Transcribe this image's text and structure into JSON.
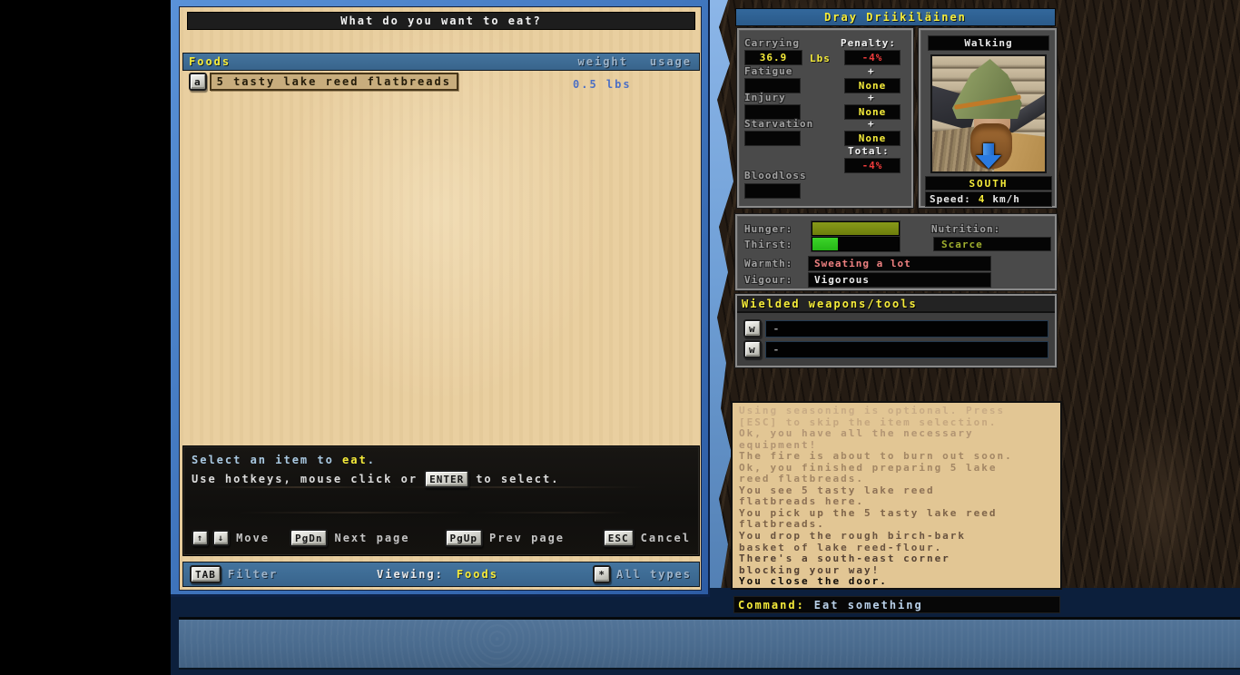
{
  "dialog": {
    "title": "What do you want to eat?",
    "list_header": {
      "category": "Foods",
      "weight_col": "weight",
      "usage_col": "usage"
    },
    "items": [
      {
        "hotkey": "a",
        "name": "5 tasty lake reed flatbreads",
        "weight": "0.5 lbs"
      }
    ],
    "prompt": {
      "line1_pre": "Select an item to ",
      "line1_verb": "eat",
      "line1_post": ".",
      "line2_pre": "Use hotkeys, mouse click or",
      "enter_key": "ENTER",
      "line2_post": "to select."
    },
    "nav": {
      "up_key": "↑",
      "down_key": "↓",
      "move_label": "Move",
      "pgdn_key": "PgDn",
      "next_label": "Next page",
      "pgup_key": "PgUp",
      "prev_label": "Prev page",
      "esc_key": "ESC",
      "cancel_label": "Cancel"
    },
    "filter_bar": {
      "tab_key": "TAB",
      "filter_label": "Filter",
      "viewing_label": "Viewing:",
      "viewing_value": "Foods",
      "star_key": "*",
      "all_types_label": "All types"
    }
  },
  "character": {
    "name": "Dray Driikiläinen",
    "stats": {
      "carrying_label": "Carrying",
      "carrying_value": "36.9",
      "carrying_unit": "Lbs",
      "penalty_label": "Penalty:",
      "penalty_value": "-4%",
      "fatigue_label": "Fatigue",
      "fatigue_value": "",
      "injury_label": "Injury",
      "injury_value": "",
      "starvation_label": "Starvation",
      "starvation_value": "",
      "plus1": "+",
      "plus2": "+",
      "plus3": "+",
      "fatigue_penalty": "None",
      "injury_penalty": "None",
      "starvation_penalty": "None",
      "total_label": "Total:",
      "total_value": "-4%",
      "bloodloss_label": "Bloodloss",
      "bloodloss_value": ""
    },
    "movement": {
      "mode": "Walking",
      "direction": "SOUTH",
      "speed_label": "Speed:",
      "speed_value": "4",
      "speed_unit": "km/h"
    },
    "condition": {
      "hunger_label": "Hunger:",
      "hunger_fill_pct": 100,
      "thirst_label": "Thirst:",
      "thirst_fill_pct": 29,
      "nutrition_label": "Nutrition:",
      "nutrition_value": "Scarce",
      "warmth_label": "Warmth:",
      "warmth_value": "Sweating a lot",
      "vigour_label": "Vigour:",
      "vigour_value": "Vigorous"
    },
    "wielded": {
      "title": "Wielded weapons/tools",
      "slots": [
        {
          "hotkey": "w",
          "item": "-"
        },
        {
          "hotkey": "w",
          "item": "-"
        }
      ]
    }
  },
  "log": {
    "lines": [
      {
        "text": "Using seasoning is optional. Press",
        "color": "#c9ac85"
      },
      {
        "text": "[ESC] to skip the item selection.",
        "color": "#c5a77f"
      },
      {
        "text": "Ok, you have all the necessary",
        "color": "#b29573"
      },
      {
        "text": "equipment!",
        "color": "#b29573"
      },
      {
        "text": "The fire is about to burn out soon.",
        "color": "#a38765"
      },
      {
        "text": "Ok, you finished preparing 5 lake",
        "color": "#a38765"
      },
      {
        "text": "reed flatbreads.",
        "color": "#a38765"
      },
      {
        "text": "You see 5 tasty lake reed",
        "color": "#8e7256"
      },
      {
        "text": "flatbreads here.",
        "color": "#8e7256"
      },
      {
        "text": "You pick up the 5 tasty lake reed",
        "color": "#7f654a"
      },
      {
        "text": "flatbreads.",
        "color": "#7f654a"
      },
      {
        "text": "You drop the rough birch-bark",
        "color": "#6a5440"
      },
      {
        "text": "basket of lake reed-flour.",
        "color": "#6a5440"
      },
      {
        "text": "There's a south-east corner",
        "color": "#544133"
      },
      {
        "text": "blocking your way!",
        "color": "#544133"
      },
      {
        "text": "You close the door.",
        "color": "#0e0b07"
      }
    ]
  },
  "command": {
    "label": "Command:",
    "value": "Eat something"
  },
  "colors": {
    "accent_yellow": "#f6ec3a",
    "penalty_red": "#f03c3c",
    "weight_blue": "#4d70c4",
    "bar_blue": "#3d6b94",
    "parchment": "#e9cfa0",
    "log_parchment": "#e2c694",
    "hunger_olive": "#7b8e12",
    "thirst_green": "#2ec81e",
    "nutrition_olive": "#9fae2e",
    "warmth_salmon": "#ee8080",
    "command_blue": "#b9d1ea"
  }
}
